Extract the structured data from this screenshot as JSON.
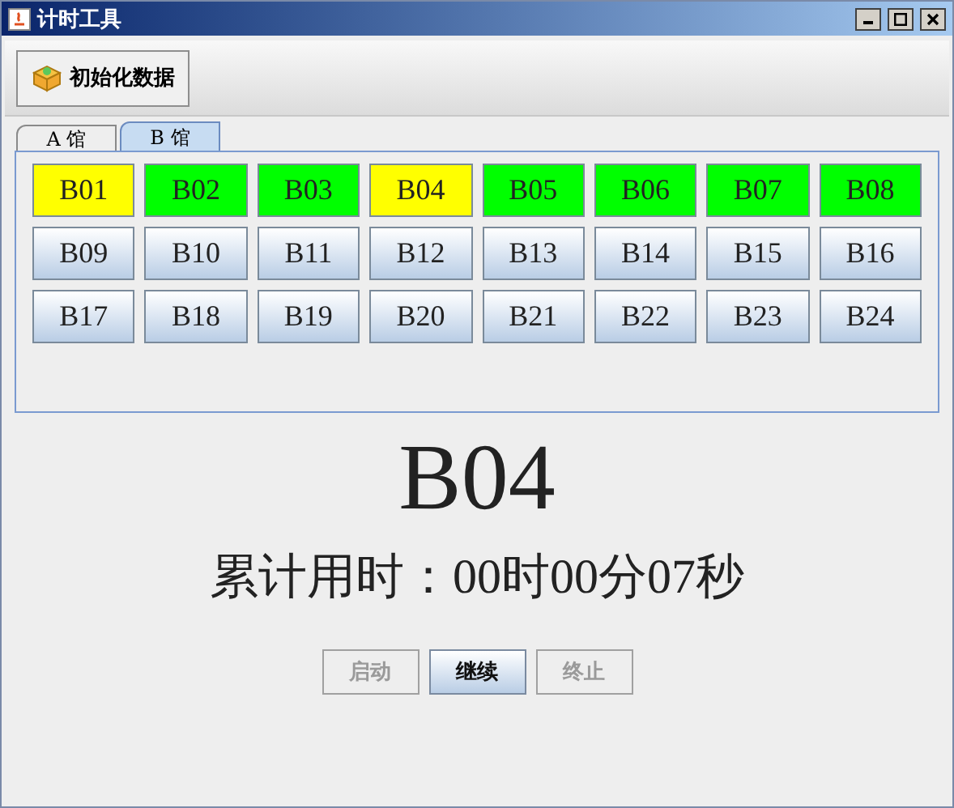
{
  "window": {
    "title": "计时工具"
  },
  "toolbar": {
    "init_button": "初始化数据"
  },
  "tabs": [
    {
      "label": "A 馆",
      "selected": false
    },
    {
      "label": "B 馆",
      "selected": true
    }
  ],
  "seats": [
    {
      "label": "B01",
      "color": "#ffff00"
    },
    {
      "label": "B02",
      "color": "#00ff00"
    },
    {
      "label": "B03",
      "color": "#00ff00"
    },
    {
      "label": "B04",
      "color": "#ffff00"
    },
    {
      "label": "B05",
      "color": "#00ff00"
    },
    {
      "label": "B06",
      "color": "#00ff00"
    },
    {
      "label": "B07",
      "color": "#00ff00"
    },
    {
      "label": "B08",
      "color": "#00ff00"
    },
    {
      "label": "B09"
    },
    {
      "label": "B10"
    },
    {
      "label": "B11"
    },
    {
      "label": "B12"
    },
    {
      "label": "B13"
    },
    {
      "label": "B14"
    },
    {
      "label": "B15"
    },
    {
      "label": "B16"
    },
    {
      "label": "B17"
    },
    {
      "label": "B18"
    },
    {
      "label": "B19"
    },
    {
      "label": "B20"
    },
    {
      "label": "B21"
    },
    {
      "label": "B22"
    },
    {
      "label": "B23"
    },
    {
      "label": "B24"
    }
  ],
  "current_seat": "B04",
  "elapsed": "累计用时：00时00分07秒",
  "buttons": [
    {
      "label": "启动",
      "disabled": true
    },
    {
      "label": "继续",
      "disabled": false
    },
    {
      "label": "终止",
      "disabled": true
    }
  ]
}
